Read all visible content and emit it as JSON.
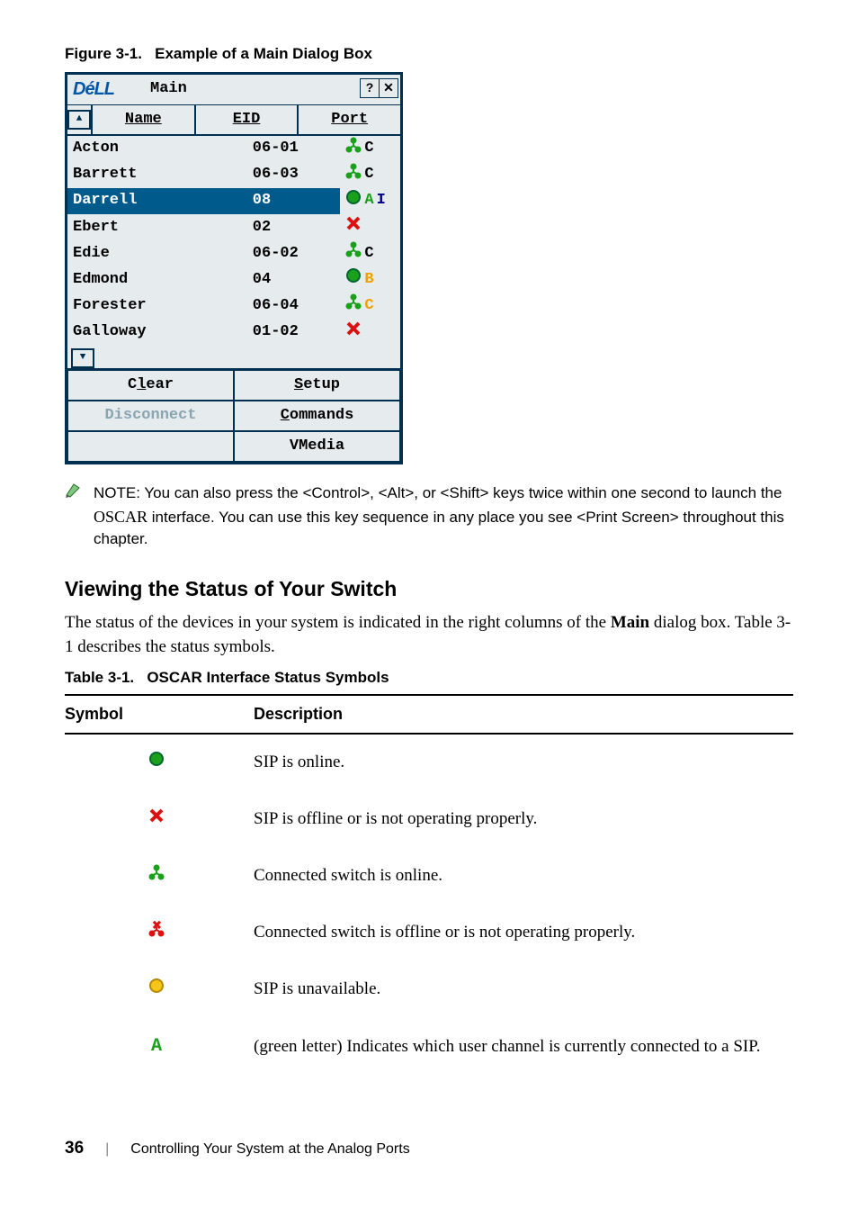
{
  "figure_caption": {
    "label": "Figure 3-1.",
    "title": "Example of a Main Dialog Box"
  },
  "dialog": {
    "logo": "DéLL",
    "title": "Main",
    "help_btn": "?",
    "close_btn": "✕",
    "tabs": {
      "name": "Name",
      "eid": "EID",
      "port": "Port"
    },
    "rows": [
      {
        "name": "Acton",
        "port": "06-01",
        "icon": "tree-green",
        "letter": "C",
        "lclass": "letter-C"
      },
      {
        "name": "Barrett",
        "port": "06-03",
        "icon": "tree-green",
        "letter": "C",
        "lclass": "letter-C"
      },
      {
        "name": "Darrell",
        "port": "08",
        "icon": "circle-green",
        "letter": "A I",
        "lclass": "letter-A",
        "selected": true,
        "extra_letter": "I",
        "extra_class": "letter-I"
      },
      {
        "name": "Ebert",
        "port": "02",
        "icon": "x-red",
        "letter": "",
        "lclass": ""
      },
      {
        "name": "Edie",
        "port": "06-02",
        "icon": "tree-green",
        "letter": "C",
        "lclass": "letter-C"
      },
      {
        "name": "Edmond",
        "port": "04",
        "icon": "circle-green",
        "letter": "B",
        "lclass": "letter-B"
      },
      {
        "name": "Forester",
        "port": "06-04",
        "icon": "tree-green",
        "letter": "C",
        "lclass": "letter-B"
      },
      {
        "name": "Galloway",
        "port": "01-02",
        "icon": "x-red",
        "letter": "",
        "lclass": ""
      }
    ],
    "buttons": {
      "clear": "Clear",
      "setup": "Setup",
      "disconnect": "Disconnect",
      "commands": "Commands",
      "vmedia": "VMedia"
    }
  },
  "note_label": "NOTE:",
  "note_text_before": "You can also press the <Control>, <Alt>, or <Shift> keys twice within one second to launch the ",
  "note_text_oscar": "OSCAR",
  "note_text_after": " interface. You can use this key sequence in any place you see <Print Screen> throughout this chapter.",
  "section_heading": "Viewing the Status of Your Switch",
  "section_body": "The status of the devices in your system is indicated in the right columns of the Main dialog box. Table 3-1 describes the status symbols.",
  "table_caption": {
    "label": "Table 3-1.",
    "title": "OSCAR Interface Status Symbols"
  },
  "table_headers": {
    "symbol": "Symbol",
    "description": "Description"
  },
  "table_rows": [
    {
      "icon": "circle-green",
      "desc": "SIP is online."
    },
    {
      "icon": "x-red",
      "desc": "SIP is offline or is not operating properly."
    },
    {
      "icon": "tree-green",
      "desc": "Connected switch is online."
    },
    {
      "icon": "tree-x-red",
      "desc": "Connected switch is offline or is not operating properly."
    },
    {
      "icon": "circle-yellow",
      "desc": "SIP is unavailable."
    },
    {
      "icon": "letter-A",
      "desc": "(green letter) Indicates which user channel is currently connected to a SIP."
    }
  ],
  "footer": {
    "page": "36",
    "title": "Controlling Your System at the Analog Ports"
  }
}
